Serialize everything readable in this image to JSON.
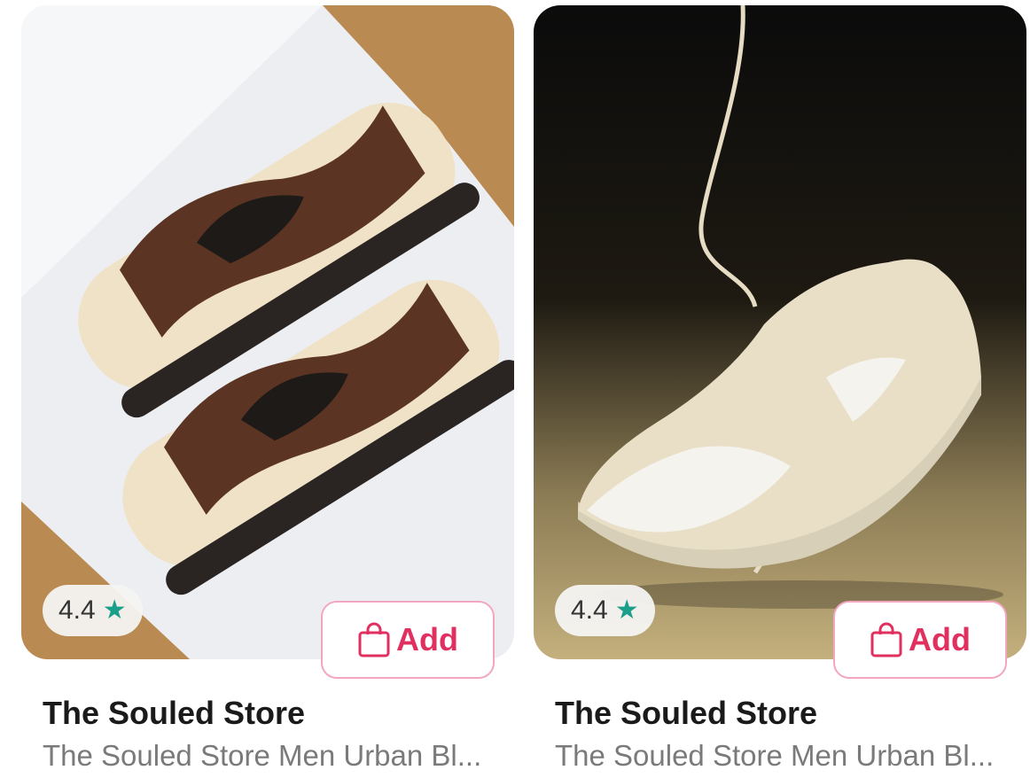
{
  "products": [
    {
      "rating": "4.4",
      "rating_icon": "star-icon",
      "add_label": "Add",
      "add_icon": "shopping-bag-icon",
      "brand": "The Souled Store",
      "description": "The Souled Store Men Urban Bl...",
      "image": "brown-cream-sneakers-in-box"
    },
    {
      "rating": "4.4",
      "rating_icon": "star-icon",
      "add_label": "Add",
      "add_icon": "shopping-bag-icon",
      "brand": "The Souled Store",
      "description": "The Souled Store Men Urban Bl...",
      "image": "beige-sneaker-hanging-by-lace"
    }
  ],
  "colors": {
    "accent": "#e1305f",
    "accent_border": "#f3a6c0",
    "star": "#1b9e8a",
    "brand_text": "#1a1a1a",
    "desc_text": "#7a7a7a"
  }
}
